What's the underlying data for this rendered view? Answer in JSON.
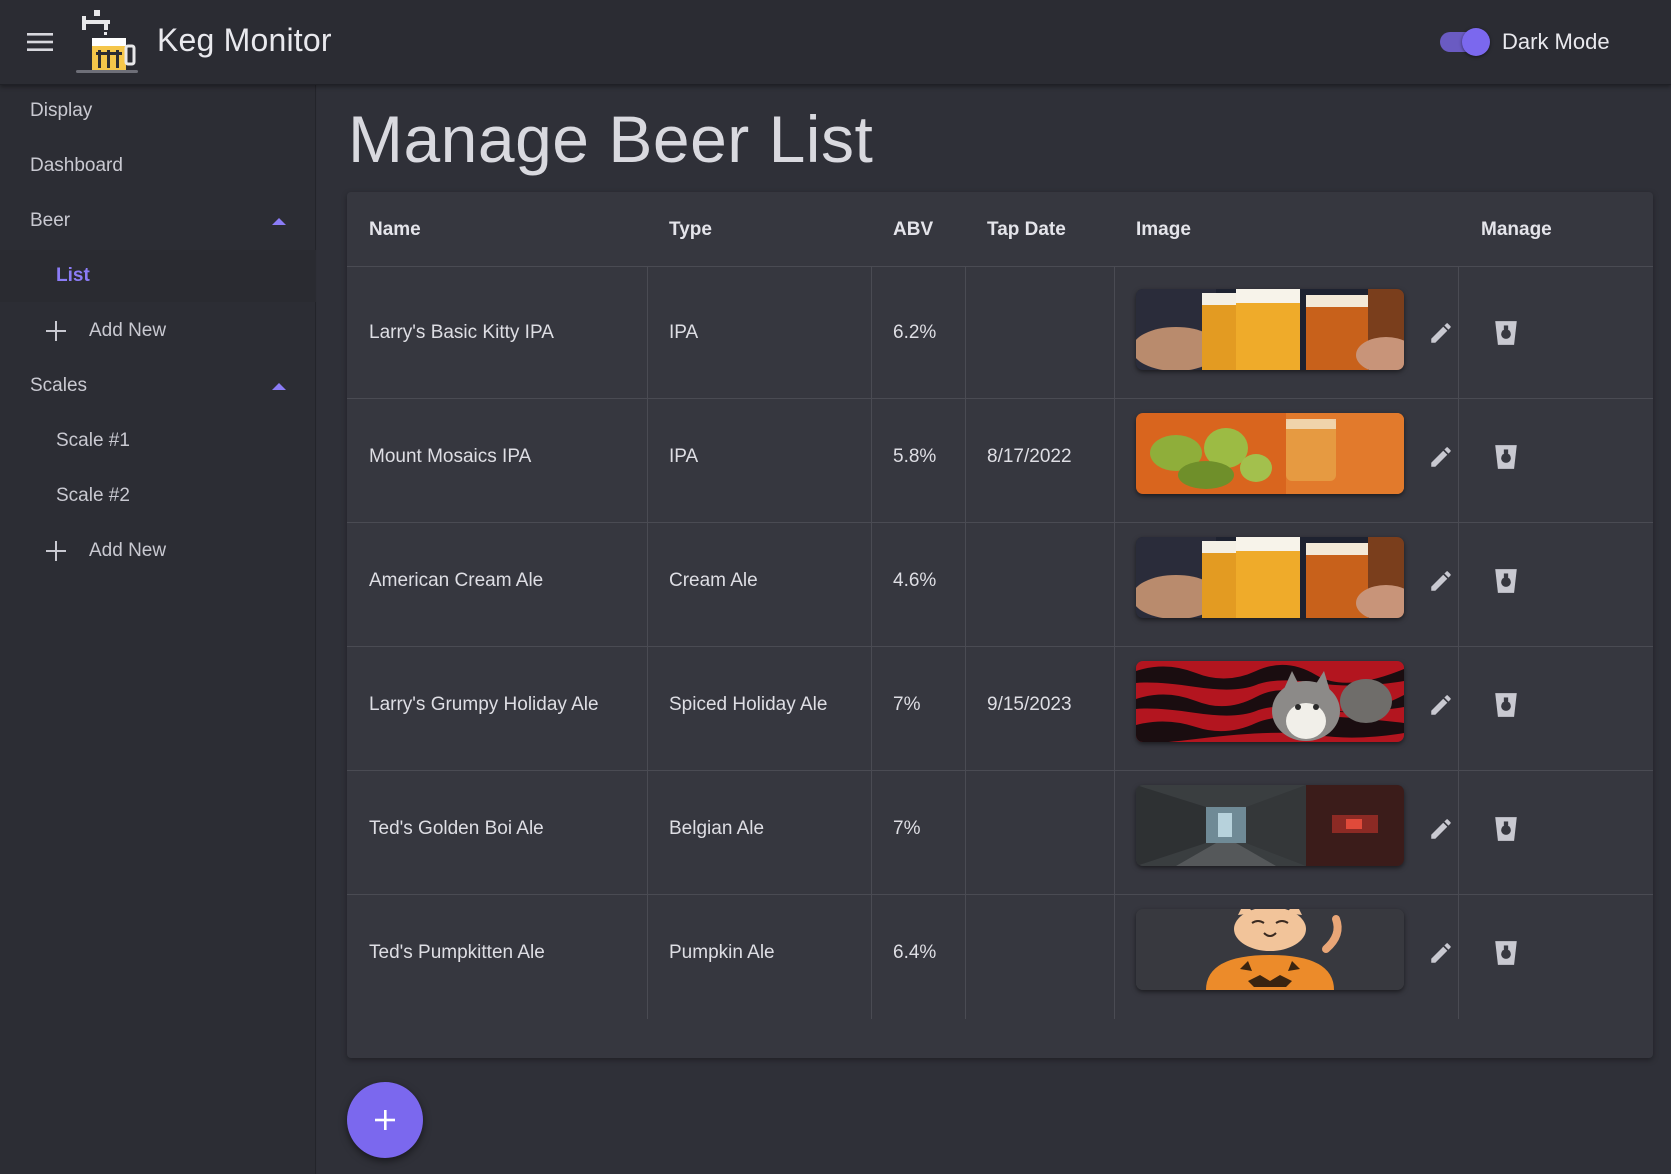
{
  "app": {
    "title": "Keg Monitor"
  },
  "header": {
    "dark_mode_label": "Dark Mode",
    "dark_mode_on": true
  },
  "sidebar": {
    "items": [
      {
        "label": "Display"
      },
      {
        "label": "Dashboard"
      },
      {
        "label": "Beer",
        "expanded": true
      },
      {
        "label": "List",
        "active": true
      },
      {
        "label": "Add New"
      },
      {
        "label": "Scales",
        "expanded": true
      },
      {
        "label": "Scale #1"
      },
      {
        "label": "Scale #2"
      },
      {
        "label": "Add New"
      }
    ]
  },
  "main": {
    "title": "Manage Beer List",
    "table": {
      "headers": [
        "Name",
        "Type",
        "ABV",
        "Tap Date",
        "Image",
        "Manage"
      ],
      "rows": [
        {
          "name": "Larry's Basic Kitty IPA",
          "type": "IPA",
          "abv": "6.2%",
          "tap_date": "",
          "image": "beer-glasses"
        },
        {
          "name": "Mount Mosaics IPA",
          "type": "IPA",
          "abv": "5.8%",
          "tap_date": "8/17/2022",
          "image": "hops-and-mug"
        },
        {
          "name": "American Cream Ale",
          "type": "Cream Ale",
          "abv": "4.6%",
          "tap_date": "",
          "image": "beer-glasses"
        },
        {
          "name": "Larry's Grumpy Holiday Ale",
          "type": "Spiced Holiday Ale",
          "abv": "7%",
          "tap_date": "9/15/2023",
          "image": "cat-on-blanket"
        },
        {
          "name": "Ted's Golden Boi Ale",
          "type": "Belgian Ale",
          "abv": "7%",
          "tap_date": "",
          "image": "scifi-corridor"
        },
        {
          "name": "Ted's Pumpkitten Ale",
          "type": "Pumpkin Ale",
          "abv": "6.4%",
          "tap_date": "",
          "image": "cat-in-pumpkin"
        }
      ]
    },
    "fab_icon": "plus-icon"
  },
  "colors": {
    "accent": "#7b68ee",
    "background": "#2f3038",
    "card": "#36373f",
    "appbar": "#2b2c33"
  }
}
